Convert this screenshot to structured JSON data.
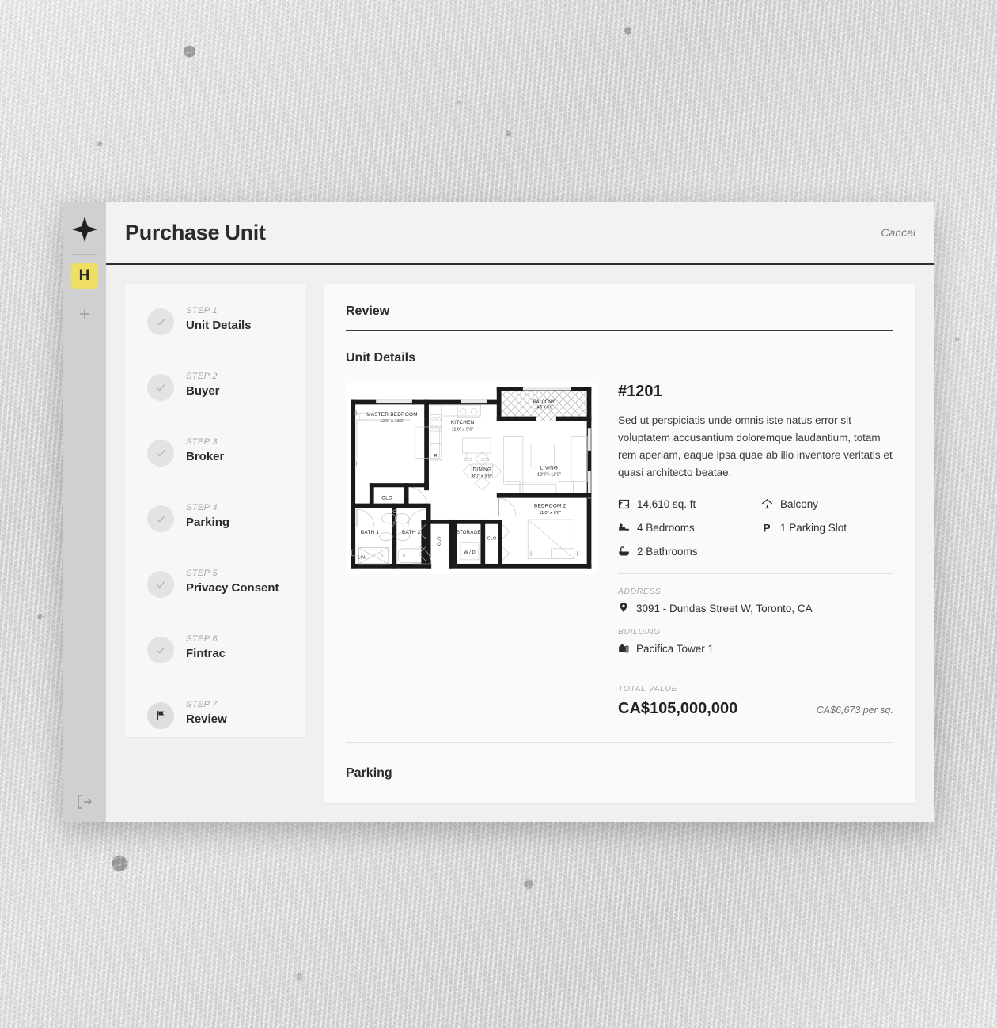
{
  "rail": {
    "logo_icon": "diamond-star-logo",
    "workspace_badge": "H",
    "add_icon": "plus-icon",
    "logout_icon": "logout-icon"
  },
  "header": {
    "title": "Purchase Unit",
    "cancel_label": "Cancel"
  },
  "stepper": {
    "steps": [
      {
        "kicker": "STEP 1",
        "label": "Unit Details",
        "state": "complete",
        "icon": "check-icon"
      },
      {
        "kicker": "STEP 2",
        "label": "Buyer",
        "state": "complete",
        "icon": "check-icon"
      },
      {
        "kicker": "STEP 3",
        "label": "Broker",
        "state": "complete",
        "icon": "check-icon"
      },
      {
        "kicker": "STEP 4",
        "label": "Parking",
        "state": "complete",
        "icon": "check-icon"
      },
      {
        "kicker": "STEP 5",
        "label": "Privacy Consent",
        "state": "complete",
        "icon": "check-icon"
      },
      {
        "kicker": "STEP 6",
        "label": "Fintrac",
        "state": "complete",
        "icon": "check-icon"
      },
      {
        "kicker": "STEP 7",
        "label": "Review",
        "state": "current",
        "icon": "flag-icon"
      }
    ]
  },
  "main": {
    "review_title": "Review",
    "unit_details_title": "Unit Details",
    "parking_title": "Parking",
    "unit": {
      "number": "#1201",
      "description": "Sed ut perspiciatis unde omnis iste natus error sit voluptatem accusantium doloremque laudantium, totam rem aperiam, eaque ipsa quae ab illo inventore veritatis et quasi architecto beatae.",
      "features": [
        {
          "icon": "area-icon",
          "label": "14,610 sq. ft"
        },
        {
          "icon": "balcony-icon",
          "label": "Balcony"
        },
        {
          "icon": "bed-icon",
          "label": "4 Bedrooms"
        },
        {
          "icon": "parking-icon",
          "label": "1 Parking Slot"
        },
        {
          "icon": "bath-icon",
          "label": "2 Bathrooms"
        }
      ],
      "address_kicker": "ADDRESS",
      "address": "3091 - Dundas Street W, Toronto, CA",
      "building_kicker": "BUILDING",
      "building": "Pacifica Tower 1",
      "total_value_kicker": "TOTAL VALUE",
      "total_value": "CA$105,000,000",
      "per_sq": "CA$6,673 per sq."
    },
    "floorplan": {
      "rooms": [
        {
          "name": "MASTER BEDROOM",
          "dims": "12'0\" x 13'0\""
        },
        {
          "name": "KITCHEN",
          "dims": "11'0\" x 9'6\""
        },
        {
          "name": "BALCONY",
          "dims": "14'6\"x 5'0\""
        },
        {
          "name": "LIVING",
          "dims": "13'9\"x 12'3\""
        },
        {
          "name": "DINING",
          "dims": "8'0\" x 9'9\""
        },
        {
          "name": "BEDROOM 2",
          "dims": "11'0\" x 9'6\""
        },
        {
          "name": "BATH 1",
          "dims": ""
        },
        {
          "name": "BATH 2",
          "dims": ""
        },
        {
          "name": "STORAGE",
          "dims": ""
        },
        {
          "name": "CLO",
          "dims": ""
        },
        {
          "name": "W / D",
          "dims": ""
        },
        {
          "name": "LIN.",
          "dims": ""
        },
        {
          "name": "R.",
          "dims": ""
        }
      ]
    }
  },
  "colors": {
    "accent_yellow": "#eede64",
    "ink": "#2b2b2b",
    "rail_bg": "#d0d0d0",
    "card_bg": "#fafaf8"
  }
}
